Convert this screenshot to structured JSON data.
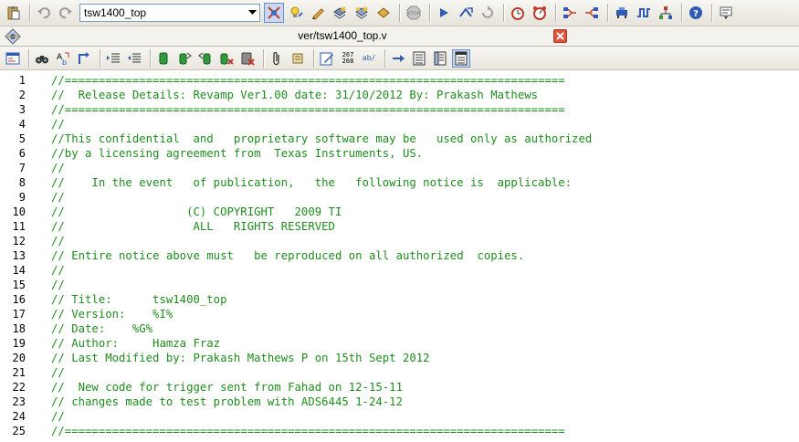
{
  "toolbar": {
    "module_select": "tsw1400_top",
    "buttons": [
      "paste-icon",
      "undo-icon",
      "redo-icon",
      "module-select",
      "cross-probe-icon",
      "light-bulb-icon",
      "pencil-icon",
      "compile-icon",
      "compile-all-icon",
      "check-icon",
      "stop-icon",
      "run-icon",
      "step-icon",
      "reset-icon",
      "timer-icon",
      "alarm-icon",
      "flow-left-icon",
      "flow-right-icon",
      "bus-icon",
      "wave-icon",
      "tree-icon",
      "help-icon",
      "dropdown-menu-icon"
    ]
  },
  "tab": {
    "title": "ver/tsw1400_top.v"
  },
  "editor_toolbar": {
    "line_numbers_label_top": "267",
    "line_numbers_label_bottom": "268",
    "abbrev_label": "ab/"
  },
  "editor": {
    "line_numbers": [
      "1",
      "2",
      "3",
      "4",
      "5",
      "6",
      "7",
      "8",
      "9",
      "10",
      "11",
      "12",
      "13",
      "14",
      "15",
      "16",
      "17",
      "18",
      "19",
      "20",
      "21",
      "22",
      "23",
      "24",
      "25"
    ],
    "lines": [
      "//==========================================================================",
      "//  Release Details: Revamp Ver1.00 date: 31/10/2012 By: Prakash Mathews",
      "//==========================================================================",
      "//",
      "//This confidential  and   proprietary software may be   used only as authorized",
      "//by a licensing agreement from  Texas Instruments, US.",
      "//",
      "//    In the event   of publication,   the   following notice is  applicable:",
      "//",
      "//                  (C) COPYRIGHT   2009 TI",
      "//                   ALL   RIGHTS RESERVED",
      "//",
      "// Entire notice above must   be reproduced on all authorized  copies.",
      "//",
      "//",
      "// Title:      tsw1400_top",
      "// Version:    %I%",
      "// Date:    %G%",
      "// Author:     Hamza Fraz",
      "// Last Modified by: Prakash Mathews P on 15th Sept 2012",
      "//",
      "//  New code for trigger sent from Fahad on 12-15-11",
      "// changes made to test problem with ADS6445 1-24-12",
      "//",
      "//=========================================================================="
    ]
  }
}
